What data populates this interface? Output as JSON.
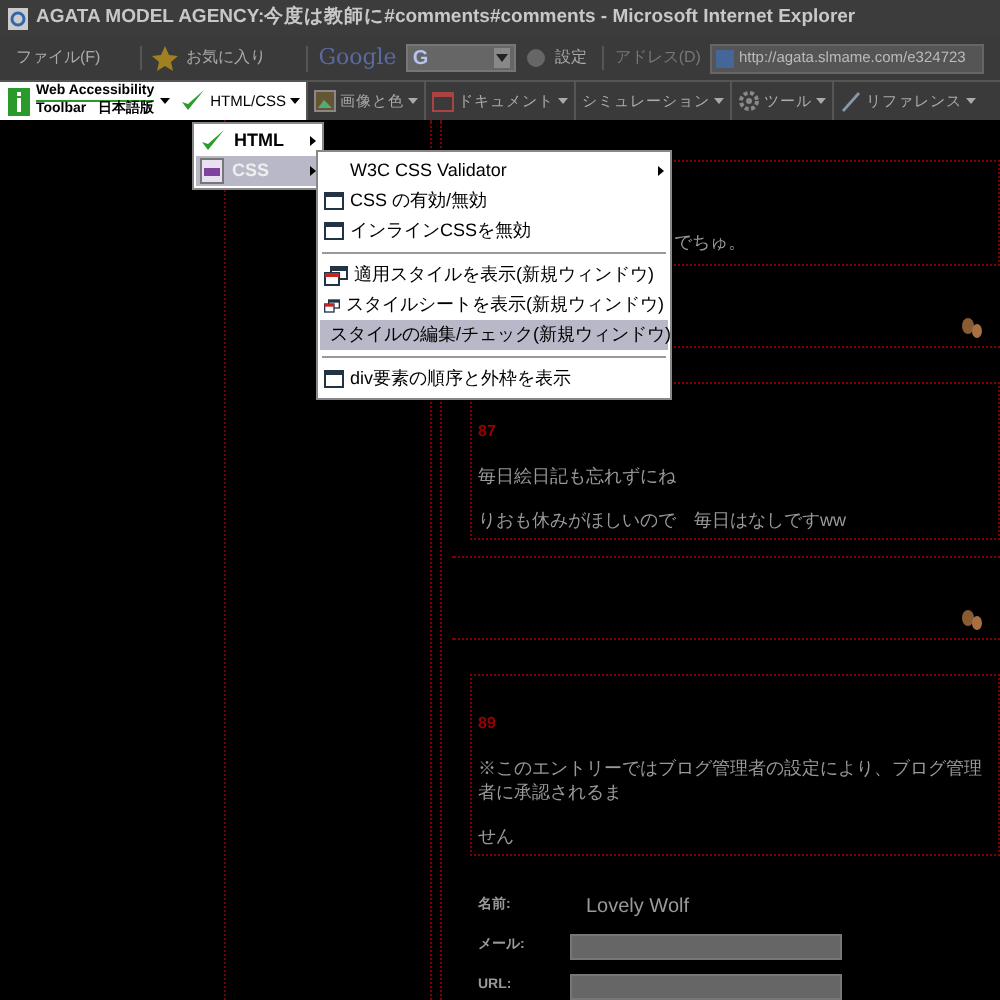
{
  "window": {
    "title": "AGATA MODEL AGENCY:今度は教師に#comments#comments - Microsoft Internet Explorer"
  },
  "toolbar": {
    "menu": "ファイル(F)",
    "favorites": "お気に入り",
    "search_logo": "Google",
    "search_engine": "G",
    "settings": "設定",
    "address_label": "アドレス(D)",
    "url": "http://agata.slmame.com/e324723"
  },
  "accessibility_toolbar": {
    "logo_lines": [
      "Web Accessibility",
      "Toolbar",
      "日本語版"
    ],
    "items": [
      {
        "label": "HTML/CSS",
        "kind": "check",
        "expanded": true
      },
      {
        "label": "画像と色",
        "kind": "image",
        "expanded": false
      },
      {
        "label": "ドキュメント",
        "kind": "doc",
        "expanded": false
      },
      {
        "label": "シミュレーション",
        "kind": "none",
        "expanded": false
      },
      {
        "label": "ツール",
        "kind": "gear",
        "expanded": false
      },
      {
        "label": "リファレンス",
        "kind": "ref",
        "expanded": false
      }
    ]
  },
  "menu": {
    "items": [
      {
        "label": "HTML",
        "kind": "check",
        "selected": false
      },
      {
        "label": "CSS",
        "kind": "css",
        "selected": true
      }
    ]
  },
  "submenu": {
    "items": [
      {
        "label": "W3C CSS Validator",
        "kind": "submenu",
        "selected": false
      },
      {
        "label": "CSS の有効/無効",
        "kind": "window",
        "selected": false
      },
      {
        "label": "インラインCSSを無効",
        "kind": "window",
        "selected": false
      },
      {
        "kind": "separator"
      },
      {
        "label": "適用スタイルを表示(新規ウィンドウ)",
        "kind": "newwindow",
        "selected": false
      },
      {
        "label": "スタイルシートを表示(新規ウィンドウ)",
        "kind": "newwindow",
        "selected": false
      },
      {
        "label": "スタイルの編集/チェック(新規ウィンドウ)",
        "kind": "newwindow",
        "selected": true
      },
      {
        "kind": "separator"
      },
      {
        "label": "div要素の順序と外枠を表示",
        "kind": "window",
        "selected": false
      }
    ]
  },
  "page": {
    "entry_fragment": "でちゅ。",
    "comments": [
      {
        "number": "87",
        "lines": [
          "毎日絵日記も忘れずにね",
          "りおも休みがほしいので　毎日はなしですww"
        ]
      },
      {
        "number": "89",
        "lines": [
          "※このエントリーではブログ管理者の設定により、ブログ管理者に承認されるま",
          "せん"
        ]
      }
    ],
    "form": [
      {
        "label": "名前:",
        "kind": "text",
        "value": "Lovely Wolf"
      },
      {
        "label": "メール:",
        "kind": "input"
      },
      {
        "label": "URL:",
        "kind": "input"
      }
    ]
  }
}
